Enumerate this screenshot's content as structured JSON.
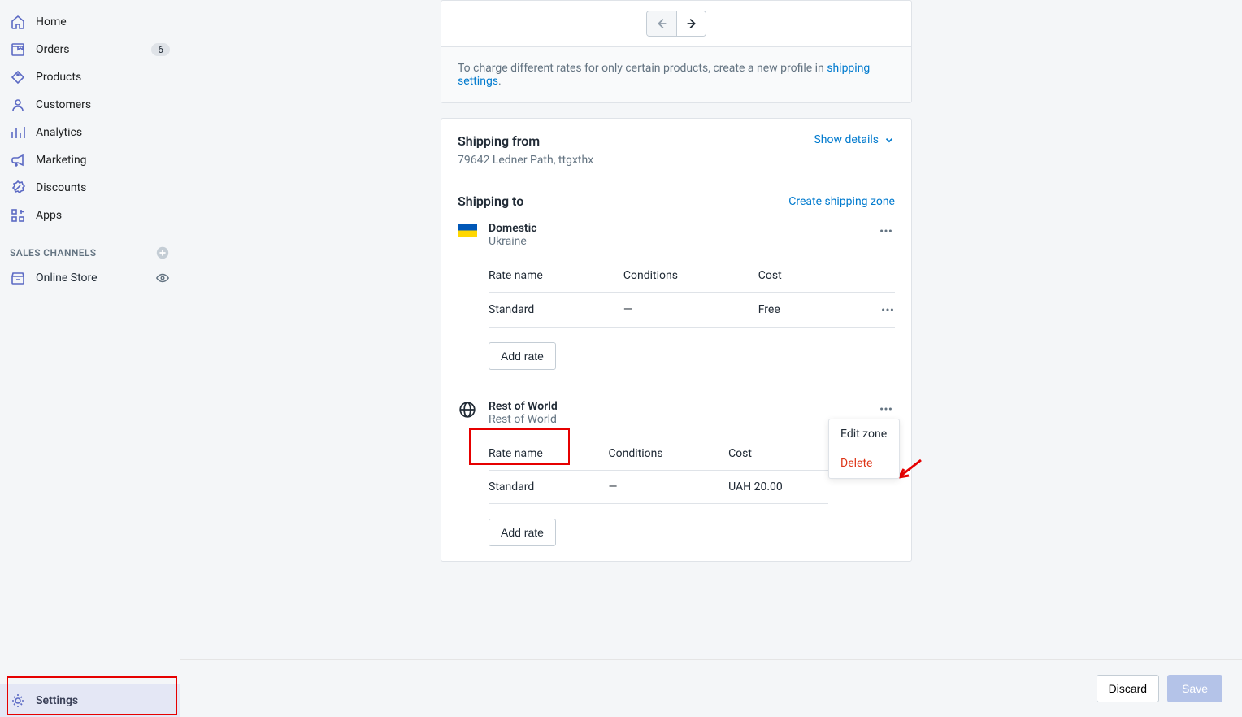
{
  "sidebar": {
    "home": "Home",
    "orders": "Orders",
    "orders_badge": "6",
    "products": "Products",
    "customers": "Customers",
    "analytics": "Analytics",
    "marketing": "Marketing",
    "discounts": "Discounts",
    "apps": "Apps",
    "sales_channels": "SALES CHANNELS",
    "online_store": "Online Store",
    "settings": "Settings"
  },
  "profile_note": {
    "text": "To charge different rates for only certain products, create a new profile in ",
    "link": "shipping settings",
    "suffix": "."
  },
  "shipping_from": {
    "title": "Shipping from",
    "address": "79642 Ledner Path, ttgxthx",
    "show_details": "Show details"
  },
  "shipping_to": {
    "title": "Shipping to",
    "create_link": "Create shipping zone"
  },
  "zone_domestic": {
    "title": "Domestic",
    "subtitle": "Ukraine",
    "headers": {
      "name": "Rate name",
      "cond": "Conditions",
      "cost": "Cost"
    },
    "row": {
      "name": "Standard",
      "cond": "—",
      "cost": "Free"
    },
    "add_rate": "Add rate"
  },
  "zone_world": {
    "title": "Rest of World",
    "subtitle": "Rest of World",
    "headers": {
      "name": "Rate name",
      "cond": "Conditions",
      "cost": "Cost"
    },
    "row": {
      "name": "Standard",
      "cond": "—",
      "cost": "UAH 20.00"
    },
    "add_rate": "Add rate"
  },
  "popover": {
    "edit": "Edit zone",
    "delete": "Delete"
  },
  "footer": {
    "discard": "Discard",
    "save": "Save"
  }
}
